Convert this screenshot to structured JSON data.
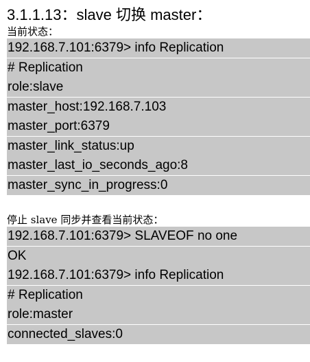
{
  "heading": "3.1.1.13：slave 切换 master：",
  "section1": {
    "label": "当前状态：",
    "lines": [
      "192.168.7.101:6379> info Replication",
      "# Replication",
      "role:slave",
      "master_host:192.168.7.103",
      "master_port:6379",
      "master_link_status:up",
      "master_last_io_seconds_ago:8",
      "master_sync_in_progress:0"
    ]
  },
  "section2": {
    "label": "停止 slave 同步并查看当前状态：",
    "lines": [
      "192.168.7.101:6379> SLAVEOF no one",
      "OK",
      "192.168.7.101:6379> info Replication",
      "# Replication",
      "role:master",
      "connected_slaves:0"
    ]
  }
}
